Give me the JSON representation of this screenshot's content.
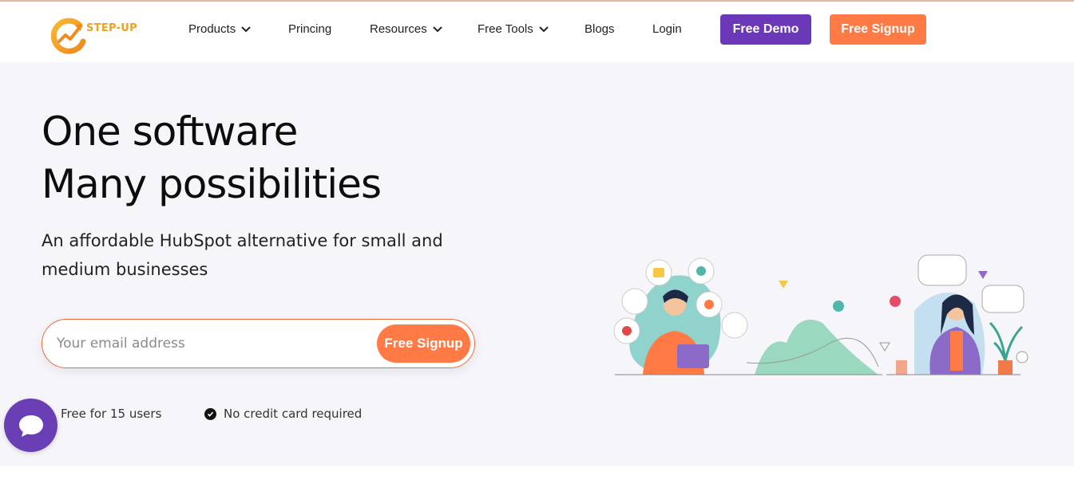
{
  "brand": {
    "logo_text": "STEP-UP",
    "accent": "#ff7a45",
    "purple": "#6a38b8"
  },
  "nav": {
    "items": [
      {
        "label": "Products",
        "dropdown": true
      },
      {
        "label": "Princing",
        "dropdown": false
      },
      {
        "label": "Resources",
        "dropdown": true
      },
      {
        "label": "Free Tools",
        "dropdown": true
      },
      {
        "label": "Blogs",
        "dropdown": false
      },
      {
        "label": "Login",
        "dropdown": false
      }
    ],
    "demo_label": "Free Demo",
    "signup_label": "Free Signup"
  },
  "hero": {
    "headline_line1": "One software",
    "headline_line2": "Many possibilities",
    "subtitle": "An affordable HubSpot alternative for small and medium businesses",
    "email_placeholder": "Your email address",
    "signup_label": "Free Signup",
    "perks": [
      "Free for 15 users",
      "No credit card required"
    ]
  },
  "icons": [
    "logo-icon",
    "chevron-down-icon",
    "check-circle-icon",
    "chat-icon"
  ]
}
